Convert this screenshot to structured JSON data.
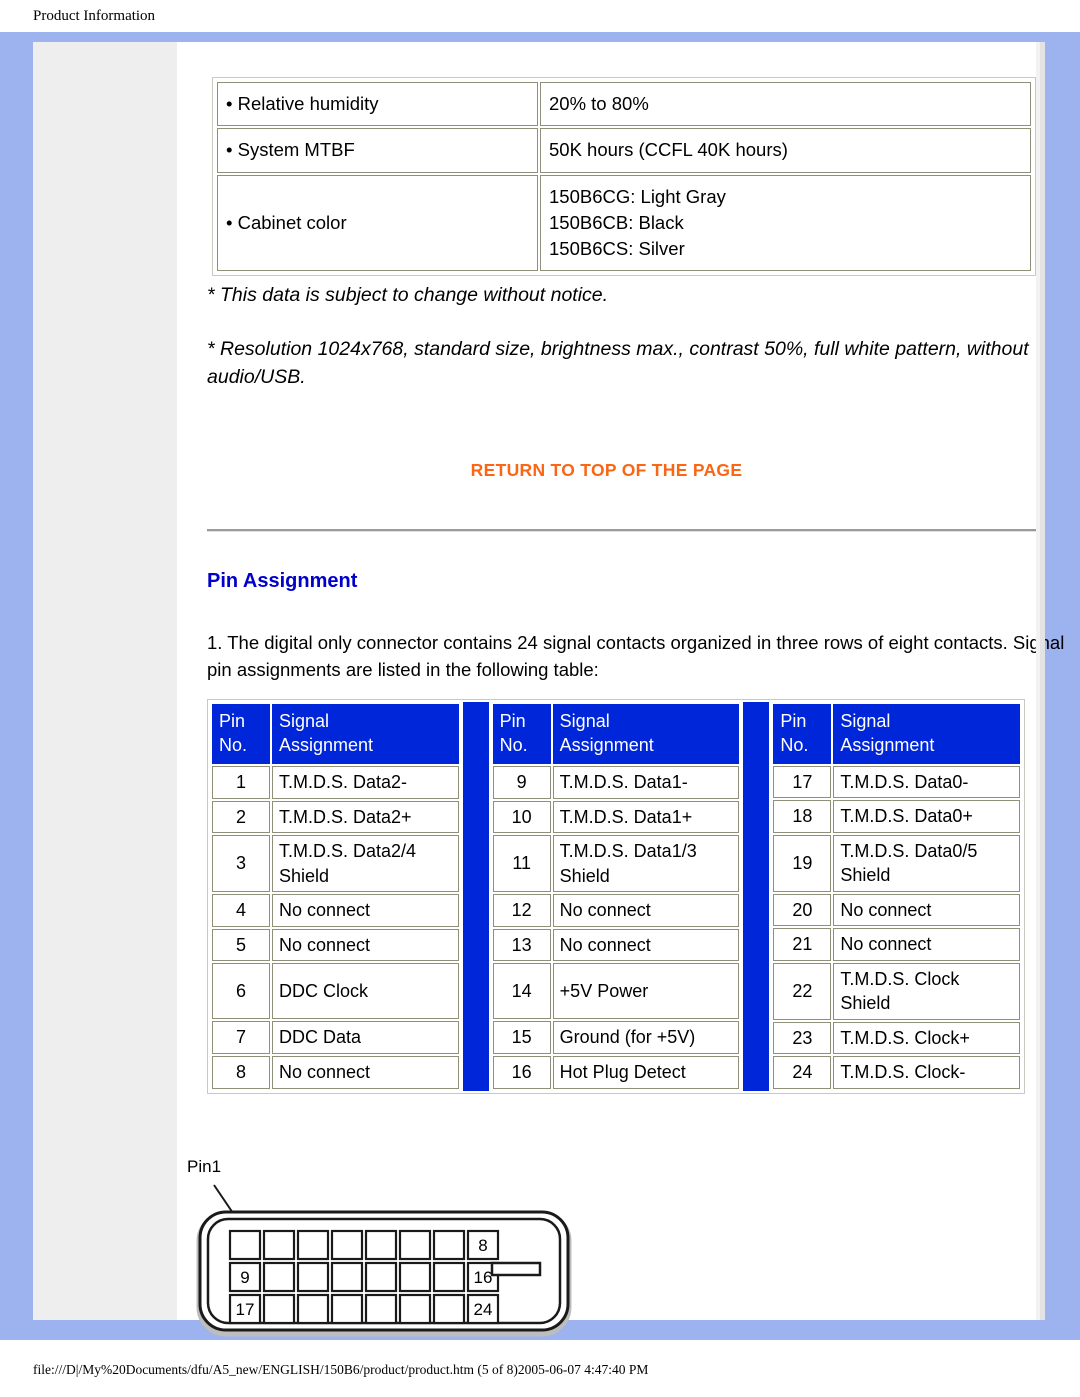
{
  "browser": {
    "print_header": "Product Information",
    "footer": "file:///D|/My%20Documents/dfu/A5_new/ENGLISH/150B6/product/product.htm (5 of 8)2005-06-07 4:47:40 PM"
  },
  "colors": {
    "page_frame_blue": "#9db3ef",
    "table_header_blue": "#0026d9",
    "heading_blue": "#0000cc",
    "link_orange": "#f96616",
    "cell_border": "#8f8f7a",
    "nav_gray": "#eeeeee"
  },
  "spec_table": {
    "rows": [
      {
        "label": "• Relative humidity",
        "value": "20% to 80%"
      },
      {
        "label": "• System MTBF",
        "value": "50K hours (CCFL 40K hours)"
      },
      {
        "label": "• Cabinet color",
        "value": "150B6CG: Light Gray\n150B6CB: Black\n150B6CS: Silver"
      }
    ]
  },
  "notes": {
    "note_1": "* This data is subject to change without notice.",
    "note_2": "* Resolution 1024x768, standard size, brightness max., contrast 50%, full white pattern, without audio/USB."
  },
  "return_link": "RETURN TO TOP OF THE PAGE",
  "pin_assignment": {
    "title": "Pin Assignment",
    "paragraph": "1. The digital only connector contains 24 signal contacts organized in three rows of eight contacts. Signal pin assignments are listed in the following table:",
    "header": {
      "pin_no": "Pin\nNo.",
      "signal": "Signal\nAssignment"
    },
    "blocks": [
      {
        "rows": [
          {
            "pin": "1",
            "signal": "T.M.D.S. Data2-",
            "tall": false
          },
          {
            "pin": "2",
            "signal": "T.M.D.S. Data2+",
            "tall": false
          },
          {
            "pin": "3",
            "signal": "T.M.D.S. Data2/4\nShield",
            "tall": true
          },
          {
            "pin": "4",
            "signal": "No connect",
            "tall": false
          },
          {
            "pin": "5",
            "signal": "No connect",
            "tall": false
          },
          {
            "pin": "6",
            "signal": "DDC Clock",
            "tall": true
          },
          {
            "pin": "7",
            "signal": "DDC Data",
            "tall": false
          },
          {
            "pin": "8",
            "signal": "No connect",
            "tall": false
          }
        ]
      },
      {
        "rows": [
          {
            "pin": "9",
            "signal": "T.M.D.S. Data1-",
            "tall": false
          },
          {
            "pin": "10",
            "signal": "T.M.D.S. Data1+",
            "tall": false
          },
          {
            "pin": "11",
            "signal": "T.M.D.S. Data1/3\nShield",
            "tall": true
          },
          {
            "pin": "12",
            "signal": "No connect",
            "tall": false
          },
          {
            "pin": "13",
            "signal": "No connect",
            "tall": false
          },
          {
            "pin": "14",
            "signal": "+5V Power",
            "tall": true
          },
          {
            "pin": "15",
            "signal": "Ground (for +5V)",
            "tall": false
          },
          {
            "pin": "16",
            "signal": "Hot Plug Detect",
            "tall": false
          }
        ]
      },
      {
        "rows": [
          {
            "pin": "17",
            "signal": "T.M.D.S. Data0-",
            "tall": false
          },
          {
            "pin": "18",
            "signal": "T.M.D.S. Data0+",
            "tall": false
          },
          {
            "pin": "19",
            "signal": "T.M.D.S. Data0/5\nShield",
            "tall": true
          },
          {
            "pin": "20",
            "signal": "No connect",
            "tall": false
          },
          {
            "pin": "21",
            "signal": "No connect",
            "tall": false
          },
          {
            "pin": "22",
            "signal": "T.M.D.S. Clock\nShield",
            "tall": true
          },
          {
            "pin": "23",
            "signal": "T.M.D.S. Clock+",
            "tall": false
          },
          {
            "pin": "24",
            "signal": "T.M.D.S. Clock-",
            "tall": false
          }
        ]
      }
    ]
  },
  "connector_diagram": {
    "pin1_label": "Pin1",
    "row_end_labels": [
      "8",
      "16",
      "24"
    ],
    "row_start_labels": [
      "",
      "9",
      "17"
    ]
  }
}
